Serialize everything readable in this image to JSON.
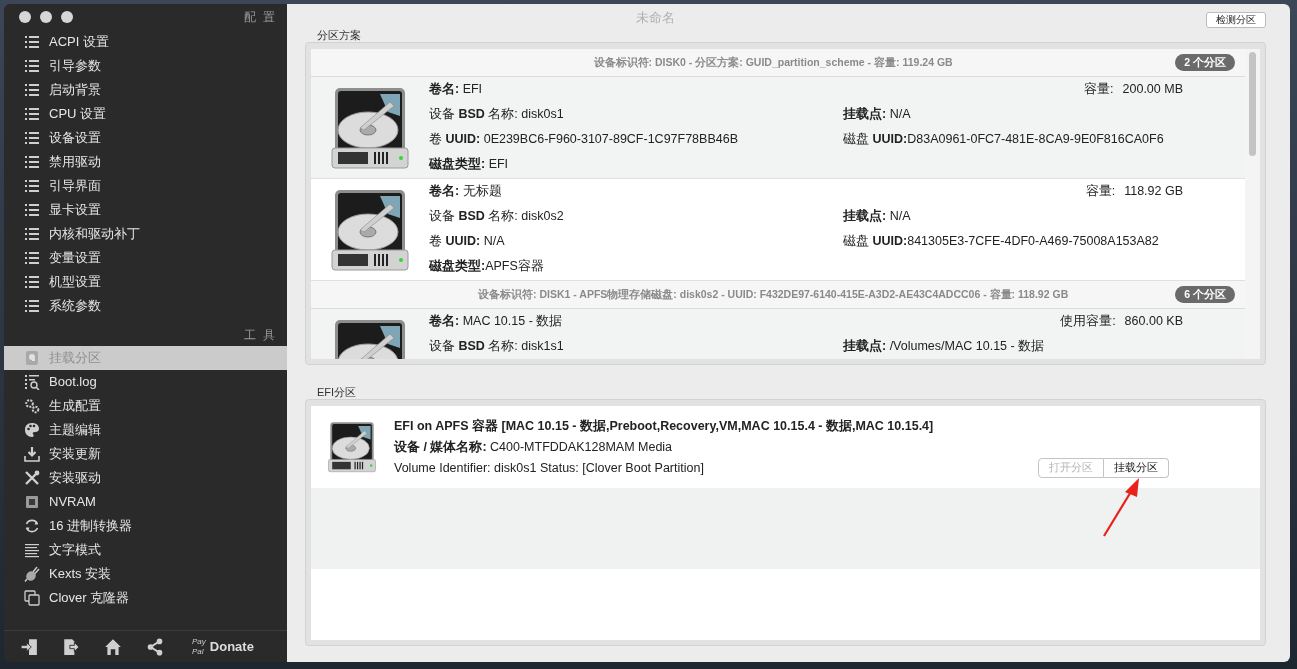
{
  "window": {
    "title": "未命名"
  },
  "sidebar": {
    "sections": [
      {
        "header": "配 置",
        "items": [
          {
            "label": "ACPI 设置",
            "kind": "list",
            "selected": false
          },
          {
            "label": "引导参数",
            "kind": "list",
            "selected": false
          },
          {
            "label": "启动背景",
            "kind": "list",
            "selected": false
          },
          {
            "label": "CPU 设置",
            "kind": "list",
            "selected": false
          },
          {
            "label": "设备设置",
            "kind": "list",
            "selected": false
          },
          {
            "label": "禁用驱动",
            "kind": "list",
            "selected": false
          },
          {
            "label": "引导界面",
            "kind": "list",
            "selected": false
          },
          {
            "label": "显卡设置",
            "kind": "list",
            "selected": false
          },
          {
            "label": "内核和驱动补丁",
            "kind": "list",
            "selected": false
          },
          {
            "label": "变量设置",
            "kind": "list",
            "selected": false
          },
          {
            "label": "机型设置",
            "kind": "list",
            "selected": false
          },
          {
            "label": "系统参数",
            "kind": "list",
            "selected": false
          }
        ]
      },
      {
        "header": "工 具",
        "items": [
          {
            "label": "挂载分区",
            "kind": "drive",
            "selected": true
          },
          {
            "label": "Boot.log",
            "kind": "log",
            "selected": false
          },
          {
            "label": "生成配置",
            "kind": "gears",
            "selected": false
          },
          {
            "label": "主题编辑",
            "kind": "palette",
            "selected": false
          },
          {
            "label": "安装更新",
            "kind": "download",
            "selected": false
          },
          {
            "label": "安装驱动",
            "kind": "tools",
            "selected": false
          },
          {
            "label": "NVRAM",
            "kind": "chip",
            "selected": false
          },
          {
            "label": "16 进制转换器",
            "kind": "refresh",
            "selected": false
          },
          {
            "label": "文字模式",
            "kind": "lines",
            "selected": false
          },
          {
            "label": "Kexts 安装",
            "kind": "plug",
            "selected": false
          },
          {
            "label": "Clover 克隆器",
            "kind": "copy",
            "selected": false
          }
        ]
      }
    ]
  },
  "toolbar": {
    "donate": {
      "pay": "Pay",
      "pal": "Pal",
      "label": "Donate"
    }
  },
  "detect_button": "检测分区",
  "partition_scheme": {
    "label": "分区方案",
    "disks": [
      {
        "header": "设备标识符: DISK0 - 分区方案: GUID_partition_scheme - 容量: 119.24 GB",
        "badge": "2 个分区",
        "partitions": [
          {
            "name": "**卷名:** EFI",
            "capacity_label": "容量:",
            "capacity": "200.00 MB",
            "bsd": "设备 **BSD** 名称: disk0s1",
            "mount": "**挂载点:** N/A",
            "volume_uuid": "卷 **UUID:** 0E239BC6-F960-3107-89CF-1C97F78BB46B",
            "disk_uuid": "磁盘 **UUID:**D83A0961-0FC7-481E-8CA9-9E0F816CA0F6",
            "type": "**磁盘类型:** EFI"
          },
          {
            "name": "**卷名:** 无标题",
            "capacity_label": "容量:",
            "capacity": "118.92 GB",
            "bsd": "设备 **BSD** 名称: disk0s2",
            "mount": "**挂载点:** N/A",
            "volume_uuid": "卷 **UUID:** N/A",
            "disk_uuid": "磁盘 **UUID:**841305E3-7CFE-4DF0-A469-75008A153A82",
            "type": "**磁盘类型:**APFS容器"
          }
        ]
      },
      {
        "header": "设备标识符: DISK1 - APFS物理存储磁盘: disk0s2 - UUID: F432DE97-6140-415E-A3D2-AE43C4ADCC06 - 容量: 118.92 GB",
        "badge": "6 个分区",
        "partitions": [
          {
            "name": "**卷名:** MAC 10.15 - 数据",
            "capacity_label": "使用容量:",
            "capacity": "860.00 KB",
            "bsd": "设备 **BSD** 名称: disk1s1",
            "mount": "**挂载点:** /Volumes/MAC 10.15 - 数据"
          }
        ]
      }
    ]
  },
  "efi": {
    "label": "EFI分区",
    "items": [
      {
        "title": "EFI on APFS 容器 [MAC 10.15 - 数据,Preboot,Recovery,VM,MAC 10.15.4 - 数据,MAC 10.15.4]",
        "media": "**设备 / 媒体名称:** C400-MTFDDAK128MAM Media",
        "status": "Volume Identifier: disk0s1 Status: [Clover Boot Partition]",
        "buttons": [
          {
            "label": "打开分区",
            "disabled": true
          },
          {
            "label": "挂载分区",
            "disabled": false
          }
        ]
      }
    ]
  }
}
